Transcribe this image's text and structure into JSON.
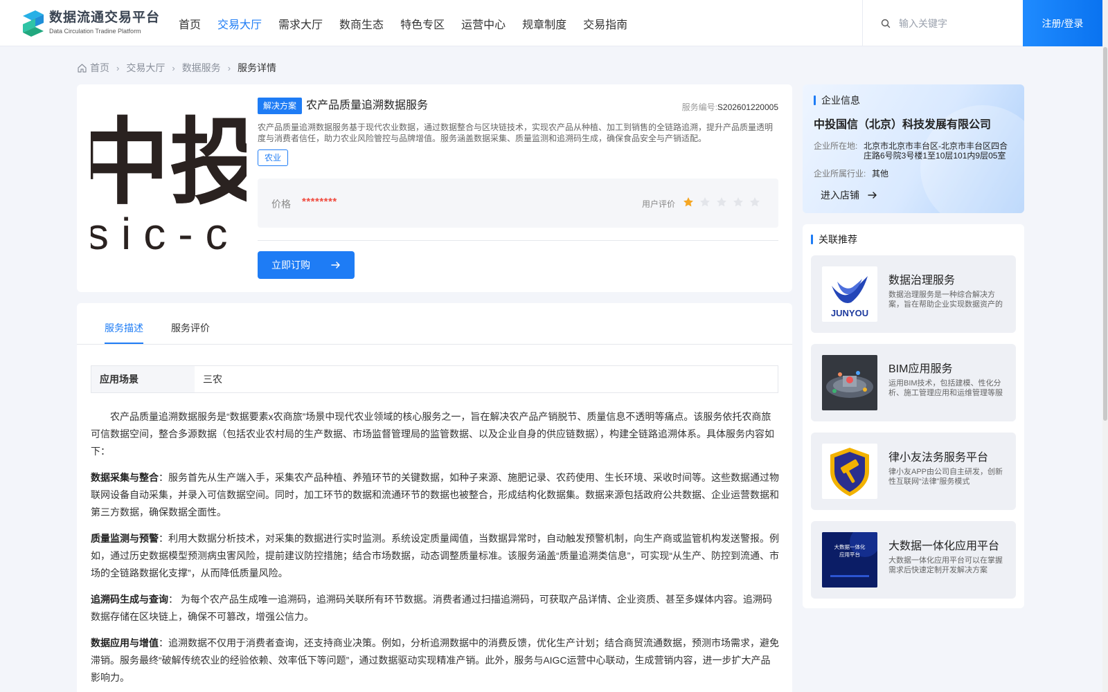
{
  "header": {
    "logo_cn": "数据流通交易平台",
    "logo_en": "Data Circulation Tradine Platform",
    "nav": [
      "首页",
      "交易大厅",
      "需求大厅",
      "数商生态",
      "特色专区",
      "运营中心",
      "规章制度",
      "交易指南"
    ],
    "active_nav": "交易大厅",
    "search_placeholder": "输入关键字",
    "login_label": "注册/登录"
  },
  "breadcrumb": {
    "home": "首页",
    "level1": "交易大厅",
    "level2": "数据服务",
    "current": "服务详情"
  },
  "product": {
    "image_text_top": "中投",
    "image_text_bottom": "sic-c",
    "type_tag": "解决方案",
    "title": "农产品质量追溯数据服务",
    "service_no_label": "服务编号:",
    "service_no": "S202601220005",
    "description": "农产品质量追溯数据服务基于现代农业数据，通过数据整合与区块链技术，实现农产品从种植、加工到销售的全链路追溯，提升产品质量透明度与消费者信任，助力农业风险管控与品牌增值。服务涵盖数据采集、质量监测和追溯码生成，确保食品安全与产销适配。",
    "industry_tag": "农业",
    "price_label": "价格",
    "price_value": "********",
    "rating_label": "用户评价",
    "rating": 1,
    "rating_max": 5,
    "buy_label": "立即订购"
  },
  "company": {
    "section_title": "企业信息",
    "name": "中投国信（北京）科技发展有限公司",
    "address_label": "企业所在地:",
    "address": "北京市北京市丰台区-北京市丰台区四合庄路6号院3号楼1至10层101内9层05室",
    "industry_label": "企业所属行业:",
    "industry": "其他",
    "enter_shop_label": "进入店铺"
  },
  "related": {
    "section_title": "关联推荐",
    "items": [
      {
        "title": "数据治理服务",
        "desc": "数据治理服务是一种综合解决方案，旨在帮助企业实现数据资产的有效管理",
        "thumb_text": "JUNYOU"
      },
      {
        "title": "BIM应用服务",
        "desc": "运用BIM技术，包括建模、性化分析、施工管理应用和运维管理等服务",
        "thumb_text": ""
      },
      {
        "title": "律小友法务服务平台",
        "desc": "律小友APP由公司自主研发，创新性互联网“法律”服务模式",
        "thumb_text": ""
      },
      {
        "title": "大数据一体化应用平台",
        "desc": "大数据一体化应用平台可以在掌握需求后快速定制开发解决方案",
        "thumb_text": "大数据一体化\n应用平台"
      }
    ]
  },
  "detail": {
    "tabs": [
      "服务描述",
      "服务评价"
    ],
    "active_tab": "服务描述",
    "scene_label": "应用场景",
    "scene_value": "三农",
    "intro": "农产品质量追溯数据服务是“数据要素x农商旅”场景中现代农业领域的核心服务之一，旨在解决农产品产销脱节、质量信息不透明等痛点。该服务依托农商旅可信数据空间，整合多源数据（包括农业农村局的生产数据、市场监督管理局的监管数据、以及企业自身的供应链数据），构建全链路追溯体系。具体服务内容如下：",
    "sections": [
      {
        "heading": "数据采集与整合",
        "text": "服务首先从生产端入手，采集农产品种植、养殖环节的关键数据，如种子来源、施肥记录、农药使用、生长环境、采收时间等。这些数据通过物联网设备自动采集，并录入可信数据空间。同时，加工环节的数据和流通环节的数据也被整合，形成结构化数据集。数据来源包括政府公共数据、企业运营数据和第三方数据，确保数据全面性。"
      },
      {
        "heading": "质量监测与预警",
        "text": "利用大数据分析技术，对采集的数据进行实时监测。系统设定质量阈值，当数据异常时，自动触发预警机制，向生产商或监管机构发送警报。例如，通过历史数据模型预测病虫害风险，提前建议防控措施；结合市场数据，动态调整质量标准。该服务涵盖“质量追溯类信息”，可实现“从生产、防控到流通、市场的全链路数据化支撑”，从而降低质量风险。"
      },
      {
        "heading": "追溯码生成与查询",
        "text": "为每个农产品生成唯一追溯码，追溯码关联所有环节数据。消费者通过扫描追溯码，可获取产品详情、企业资质、甚至多媒体内容。追溯码数据存储在区块链上，确保不可篡改，增强公信力。"
      },
      {
        "heading": "数据应用与增值",
        "text": "追溯数据不仅用于消费者查询，还支持商业决策。例如，分析追溯数据中的消费反馈，优化生产计划；结合商贸流通数据，预测市场需求，避免滞销。服务最终“破解传统农业的经验依赖、效率低下等问题”，通过数据驱动实现精准产销。此外，服务与AIGC运营中心联动，生成营销内容，进一步扩大产品影响力。"
      }
    ]
  },
  "colors": {
    "primary": "#1e7cf5",
    "price": "#f04a3e",
    "star_on": "#f5a623",
    "star_off": "#e3e5ea"
  }
}
